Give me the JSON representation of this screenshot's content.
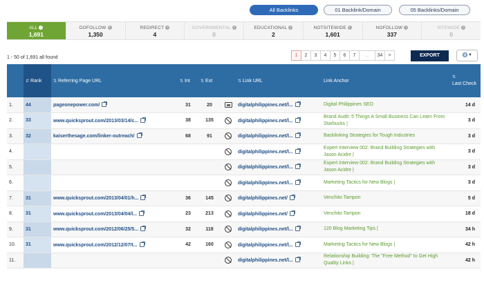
{
  "view_toggles": [
    {
      "label": "All Backlinks",
      "active": true
    },
    {
      "label": "01 Backlink/Domain",
      "active": false
    },
    {
      "label": "05 Backlinks/Domain",
      "active": false
    }
  ],
  "filter_tabs": [
    {
      "label": "ALL",
      "count": "1,691",
      "active": true
    },
    {
      "label": "DOFOLLOW",
      "count": "1,350"
    },
    {
      "label": "REDIRECT",
      "count": "4"
    },
    {
      "label": "GOVERNMENTAL",
      "count": "0",
      "dim": true
    },
    {
      "label": "EDUCATIONAL",
      "count": "2"
    },
    {
      "label": "NOTSITEWIDE",
      "count": "1,601"
    },
    {
      "label": "NOFOLLOW",
      "count": "337"
    },
    {
      "label": "SITEWIDE",
      "count": "0",
      "dim": true
    }
  ],
  "results_text": "1 - 50 of 1,691 all found",
  "pagination": [
    "1",
    "2",
    "3",
    "4",
    "5",
    "6",
    "7",
    "...",
    "34",
    ">"
  ],
  "export_label": "EXPORT",
  "table": {
    "headers": {
      "rank": "Rank",
      "referring": "Referring Page URL",
      "int": "Int",
      "ext": "Ext",
      "link_url": "Link URL",
      "anchor": "Link Anchor",
      "last_check": "Last Check"
    },
    "rows": [
      {
        "n": "1.",
        "rank": "44",
        "ref": "pageonepower.com/",
        "int": "31",
        "ext": "20",
        "icon": "image",
        "link": "digitalphilippines.net/l...",
        "anchor": "Digital Philippines SEO",
        "check": "14 d"
      },
      {
        "n": "2.",
        "rank": "33",
        "ref": "www.quicksprout.com/2013/03/14/c...",
        "int": "38",
        "ext": "135",
        "icon": "nofollow",
        "link": "digitalphilippines.net/l...",
        "anchor": "Brand Audit: 5 Things A Small Business Can Learn From Starbucks |",
        "check": "3 d"
      },
      {
        "n": "3.",
        "rank": "32",
        "ref": "kaiserthesage.com/linker-outreach/",
        "int": "68",
        "ext": "91",
        "icon": "nofollow",
        "link": "digitalphilippines.net/l...",
        "anchor": "Backlinking Strategies for Tough Industries",
        "check": "3 d"
      },
      {
        "n": "4.",
        "rank": "",
        "ref": "",
        "int": "",
        "ext": "",
        "icon": "nofollow",
        "link": "digitalphilippines.net/l...",
        "anchor": "Expert Interview 002: Brand Building Strategies with Jason Acidre |",
        "check": "3 d"
      },
      {
        "n": "5.",
        "rank": "",
        "ref": "",
        "int": "",
        "ext": "",
        "icon": "nofollow",
        "link": "digitalphilippines.net/l...",
        "anchor": "Expert Interview 002: Brand Building Strategies with Jason Acidre |",
        "check": "3 d"
      },
      {
        "n": "6.",
        "rank": "",
        "ref": "",
        "int": "",
        "ext": "",
        "icon": "nofollow",
        "link": "digitalphilippines.net/l...",
        "anchor": "Marketing Tactics for New Blogs |",
        "check": "3 d"
      },
      {
        "n": "7.",
        "rank": "31",
        "ref": "www.quicksprout.com/2013/04/01/h...",
        "int": "36",
        "ext": "145",
        "icon": "nofollow",
        "link": "digitalphilippines.net/",
        "anchor": "Venchito Tampon",
        "check": "5 d"
      },
      {
        "n": "8.",
        "rank": "31",
        "ref": "www.quicksprout.com/2013/04/04/l...",
        "int": "23",
        "ext": "213",
        "icon": "nofollow",
        "link": "digitalphilippines.net/",
        "anchor": "Venchito Tampon",
        "check": "18 d"
      },
      {
        "n": "9.",
        "rank": "31",
        "ref": "www.quicksprout.com/2012/06/25/5...",
        "int": "32",
        "ext": "118",
        "icon": "nofollow",
        "link": "digitalphilippines.net/l...",
        "anchor": "120 Blog Marketing Tips |",
        "check": "34 h"
      },
      {
        "n": "10.",
        "rank": "31",
        "ref": "www.quicksprout.com/2012/12/07/t...",
        "int": "42",
        "ext": "160",
        "icon": "nofollow",
        "link": "digitalphilippines.net/l...",
        "anchor": "Marketing Tactics for New Blogs |",
        "check": "42 h"
      },
      {
        "n": "11.",
        "rank": "",
        "ref": "",
        "int": "",
        "ext": "",
        "icon": "nofollow",
        "link": "digitalphilippines.net/l...",
        "anchor": "Relationship Building: The \"Free Method\" to Get High Quality Links |",
        "check": "42 h"
      }
    ]
  }
}
